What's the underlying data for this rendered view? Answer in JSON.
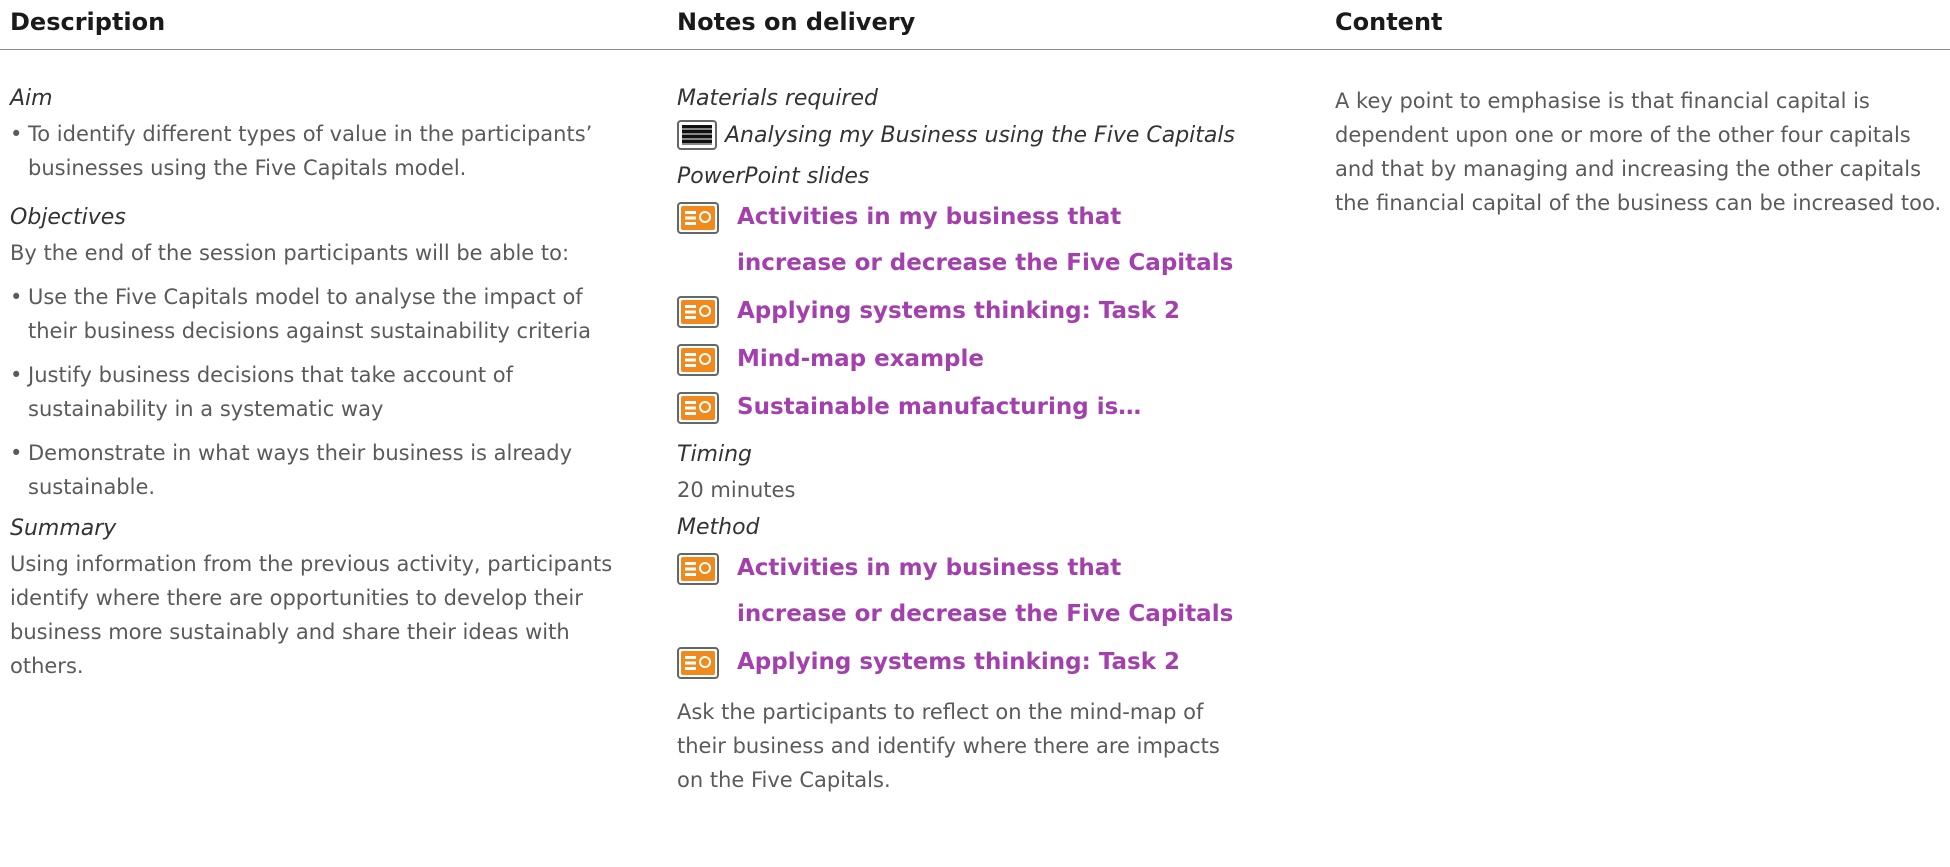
{
  "headers": {
    "description": "Description",
    "notes": "Notes on delivery",
    "content": "Content"
  },
  "description": {
    "aim_heading": "Aim",
    "aim_bullet": "To identify different types of value in the participants’ businesses using the Five Capitals model.",
    "objectives_heading": "Objectives",
    "objectives_intro": "By the end of the session participants will be able to:",
    "objectives": [
      "Use the Five Capitals model to analyse the impact of their business decisions against sustainability criteria",
      "Justify business decisions that take account of sustainability in a systematic way",
      "Demonstrate in what ways their business is already sustainable."
    ],
    "summary_heading": "Summary",
    "summary_text": "Using information from the previous activity, participants identify where there are opportunities to develop their business more sustainably and share their ideas with others."
  },
  "notes": {
    "materials_heading": "Materials required",
    "material_item": "Analysing my Business using the Five Capitals",
    "slides_heading": "PowerPoint slides",
    "slides": [
      "Activities in my business that increase or decrease the Five Capitals",
      "Applying systems thinking: Task 2",
      "Mind-map example",
      "Sustainable manufacturing is…"
    ],
    "timing_heading": "Timing",
    "timing_value": "20 minutes",
    "method_heading": "Method",
    "method_slides": [
      "Activities in my business that increase or decrease the Five Capitals",
      "Applying systems thinking: Task 2"
    ],
    "method_text": "Ask the participants to reflect on the mind-map of their business and identify where there are impacts on the Five Capitals."
  },
  "content": {
    "text": "A key point to emphasise is that financial capital is dependent upon one or more of the other four capitals and that by managing and increasing the other capitals the financial capital of the business can be increased too."
  },
  "colors": {
    "slide_link": "#a43fae",
    "ppt_icon": "#f08a1c"
  },
  "icons": {
    "document": "document-icon",
    "powerpoint": "powerpoint-slide-icon"
  }
}
